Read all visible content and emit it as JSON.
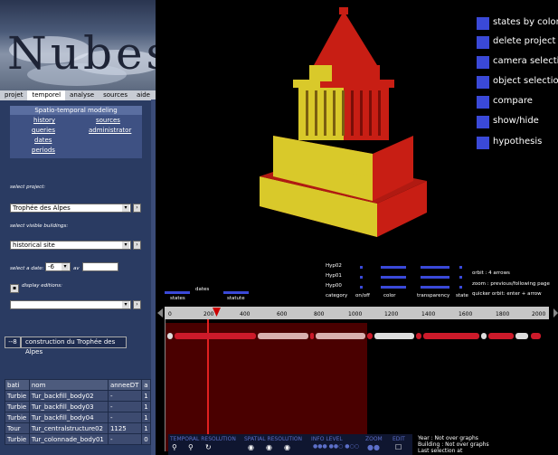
{
  "app": {
    "logo_text": "Nubes"
  },
  "menu": [
    "projet",
    "temporel",
    "analyse",
    "sources",
    "aide"
  ],
  "modeling": {
    "title": "Spatio-temporal modeling",
    "links": [
      "history",
      "sources",
      "queries",
      "administrator",
      "dates",
      "periods"
    ]
  },
  "form": {
    "select_project_label": "select project:",
    "project_value": "Trophée des Alpes",
    "select_buildings_label": "select visible buildings:",
    "buildings_value": "historical site",
    "select_date_label": "select a date:",
    "date_value": "-6",
    "date_unit": "av",
    "display_editions_label": "display editions:",
    "id_button": "--8",
    "construct_button": "construction du Trophée des Alpes"
  },
  "table": {
    "headers": [
      "bati",
      "nom",
      "anneeDT",
      "a"
    ],
    "rows": [
      [
        "Turbie",
        "Tur_backfill_body02",
        "-",
        "1"
      ],
      [
        "Turbie",
        "Tur_backfill_body03",
        "-",
        "1"
      ],
      [
        "Turbie",
        "Tur_backfill_body04",
        "-",
        "1"
      ],
      [
        "Tour",
        "Tur_centralstructure02",
        "1125",
        "1"
      ],
      [
        "Turbie",
        "Tur_colonnade_body01",
        "-",
        "0"
      ]
    ]
  },
  "options": [
    "states by colors",
    "delete project fro",
    "camera selection",
    "object selection",
    "compare",
    "show/hide",
    "hypothesis"
  ],
  "states": {
    "dates_label": "dates",
    "rows": [
      "Hyp02",
      "Hyp01",
      "Hyp00"
    ],
    "columns": [
      "category",
      "on/off",
      "color",
      "transparency",
      "state"
    ],
    "col_states": "states",
    "col_statute": "statute",
    "help": [
      "orbit : 4 arrows",
      "zoom : previous/following page",
      "quicker orbit: enter + arrow"
    ]
  },
  "timeline": {
    "ticks": [
      "0",
      "200",
      "400",
      "600",
      "800",
      "1000",
      "1200",
      "1400",
      "1600",
      "1800",
      "2000"
    ],
    "marker_value": "-6"
  },
  "bottom": {
    "temporal": "TEMPORAL RESOLUTION",
    "spatial": "SPATIAL RESOLUTION",
    "info": "INFO LEVEL",
    "zoom": "ZOOM",
    "edit": "EDIT",
    "status": [
      "Year : Not over graphs",
      "Building : Not over graphs",
      "Last selection at"
    ]
  },
  "colors": {
    "accent": "#3a49d8",
    "panel": "#2a3b62",
    "timeline_red": "#cc1a2a",
    "model_red": "#c81e14",
    "model_yellow": "#d9c92a"
  }
}
